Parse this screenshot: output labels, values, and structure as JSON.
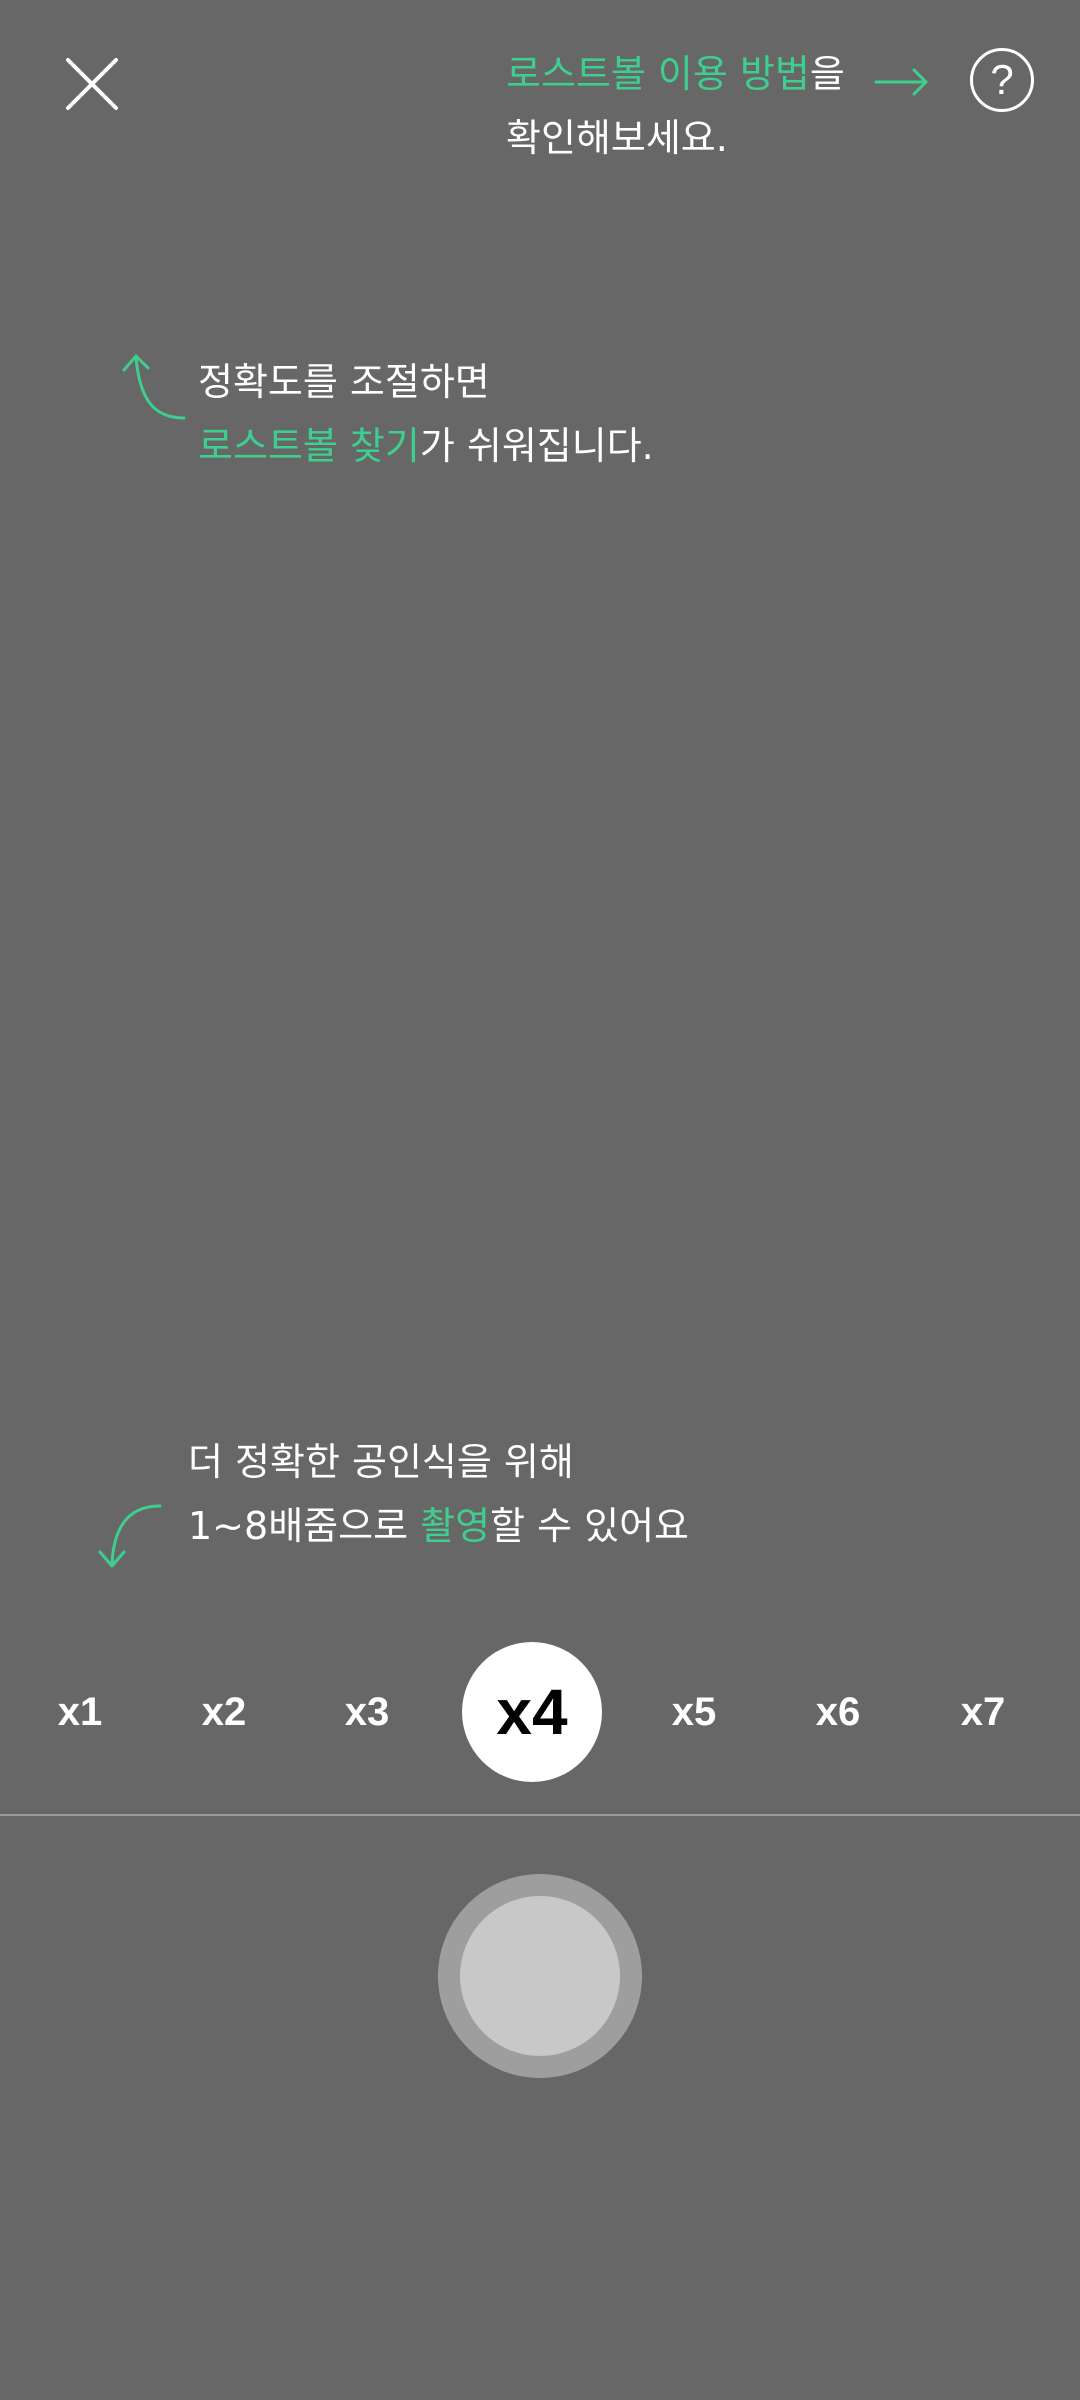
{
  "colors": {
    "background": "#676767",
    "accent_green": "#3ecf8e",
    "text": "#ffffff",
    "shutter_ring": "#9e9e9e",
    "shutter_fill": "#c8c8c8"
  },
  "icons": {
    "close": "close-icon",
    "help": "question-mark-icon",
    "arrows": "curved-arrow-icon"
  },
  "help_tip": {
    "line1_highlight": "로스트볼 이용 방법",
    "line1_rest": "을",
    "line2": "확인해보세요.",
    "button_symbol": "?"
  },
  "accuracy_tip": {
    "line1": "정확도를 조절하면",
    "line2_highlight": "로스트볼 찾기",
    "line2_rest": "가 쉬워집니다."
  },
  "zoom_tip": {
    "line1": "더 정확한 공인식을 위해",
    "line2_before": "1~8배줌으로 ",
    "line2_highlight": "촬영",
    "line2_after": "할 수 있어요"
  },
  "zoom": {
    "options": [
      "x1",
      "x2",
      "x3",
      "x4",
      "x5",
      "x6",
      "x7"
    ],
    "selected": "x4"
  }
}
